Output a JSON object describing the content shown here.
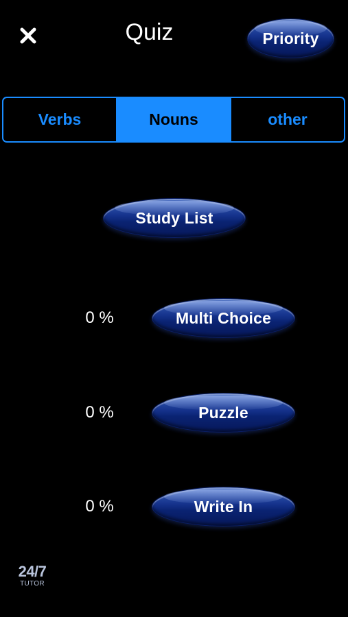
{
  "header": {
    "title": "Quiz",
    "close_icon": "close-icon",
    "priority_label": "Priority"
  },
  "tabs": [
    {
      "label": "Verbs",
      "selected": false
    },
    {
      "label": "Nouns",
      "selected": true
    },
    {
      "label": "other",
      "selected": false
    }
  ],
  "study_list": {
    "label": "Study List"
  },
  "activities": [
    {
      "label": "Multi Choice",
      "progress": "0 %"
    },
    {
      "label": "Puzzle",
      "progress": "0 %"
    },
    {
      "label": "Write In",
      "progress": "0 %"
    }
  ],
  "logo": {
    "main": "24/7",
    "sub": "TUTOR"
  },
  "colors": {
    "background": "#000000",
    "accent": "#1a8cff",
    "button_dark": "#0a2372"
  }
}
